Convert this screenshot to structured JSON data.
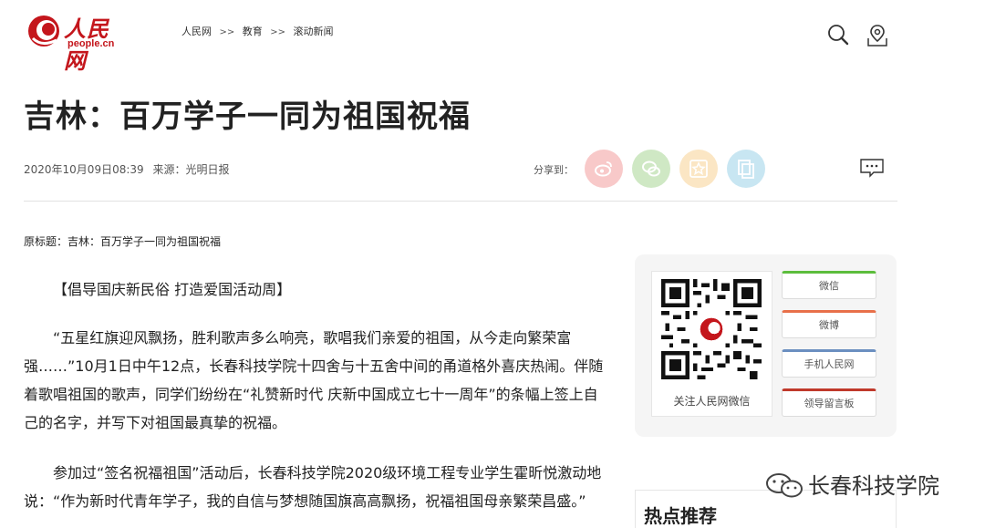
{
  "header": {
    "logo_cn": "人民网",
    "logo_en": "people.cn",
    "breadcrumb": [
      "人民网",
      "教育",
      "滚动新闻"
    ],
    "breadcrumb_sep": ">>"
  },
  "article": {
    "title": "吉林：百万学子一同为祖国祝福",
    "date": "2020年10月09日08:39",
    "source": "来源：光明日报",
    "share_label": "分享到：",
    "original_title": "原标题：吉林：百万学子一同为祖国祝福",
    "paragraphs": [
      "【倡导国庆新民俗 打造爱国活动周】",
      "“五星红旗迎风飘扬，胜利歌声多么响亮，歌唱我们亲爱的祖国，从今走向繁荣富强……”10月1日中午12点，长春科技学院十四舍与十五舍中间的甬道格外喜庆热闹。伴随着歌唱祖国的歌声，同学们纷纷在“礼赞新时代 庆新中国成立七十一周年”的条幅上签上自己的名字，并写下对祖国最真挚的祝福。",
      "参加过“签名祝福祖国”活动后，长春科技学院2020级环境工程专业学生霍昕悦激动地说：“作为新时代青年学子，我的自信与梦想随国旗高高飘扬，祝福祖国母亲繁荣昌盛。”"
    ]
  },
  "sidebar": {
    "qr_caption": "关注人民网微信",
    "links": [
      "微信",
      "微博",
      "手机人民网",
      "领导留言板"
    ],
    "hot_title": "热点推荐"
  },
  "watermark": {
    "text": "长春科技学院"
  },
  "colors": {
    "brand_red": "#c4161c",
    "weibo_bg": "#f8c9c9",
    "wechat_bg": "#cfe8c4",
    "fav_bg": "#fbe6c4",
    "copy_bg": "#c8e6f2"
  },
  "icons": [
    "search-icon",
    "location-icon",
    "weibo-icon",
    "wechat-icon",
    "favorite-icon",
    "copy-icon",
    "comment-icon"
  ]
}
